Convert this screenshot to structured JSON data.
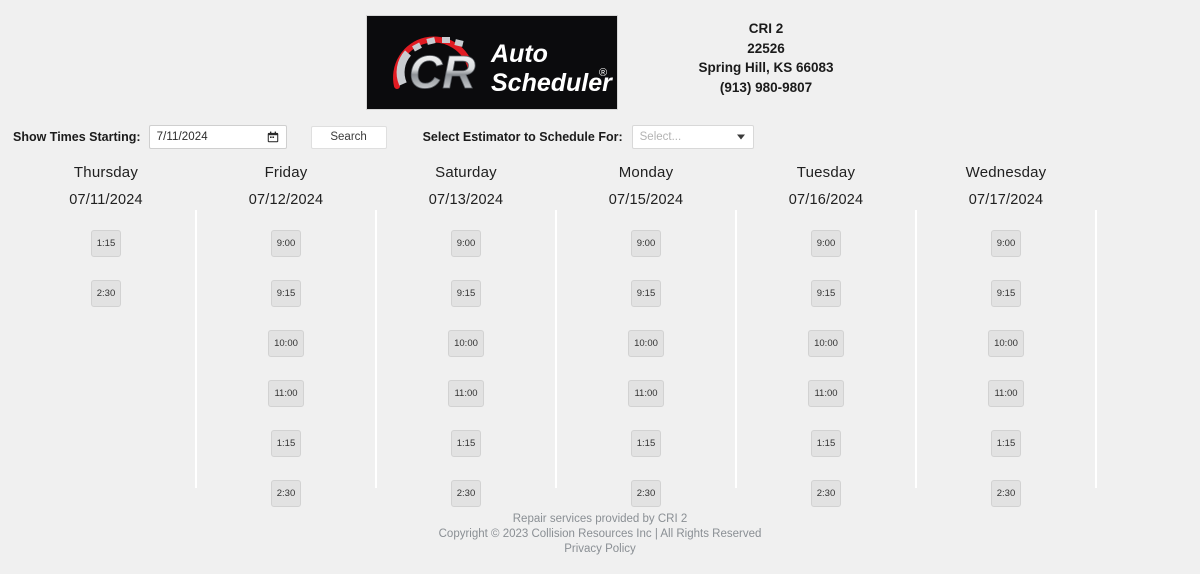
{
  "header": {
    "logo_alt": "CR Auto Scheduler",
    "logo_text_cr": "CR",
    "logo_text_auto": "Auto",
    "logo_text_scheduler": "Scheduler",
    "logo_registered": "®",
    "shop": {
      "name": "CRI 2",
      "number": "22526",
      "city_state_zip": "Spring Hill, KS 66083",
      "phone": "(913) 980-9807"
    }
  },
  "toolbar": {
    "show_times_label": "Show Times Starting:",
    "date_value": "7/11/2024",
    "date_placeholder": "mm/dd/yyyy",
    "calendar_icon": "calendar-icon",
    "search_label": "Search",
    "estimator_label": "Select Estimator to Schedule For:",
    "estimator_selected": "Select...",
    "estimator_caret": "chevron-down-icon"
  },
  "calendar": {
    "days": [
      {
        "name": "Thursday",
        "date": "07/11/2024",
        "slots": [
          "1:15",
          "2:30"
        ]
      },
      {
        "name": "Friday",
        "date": "07/12/2024",
        "slots": [
          "9:00",
          "9:15",
          "10:00",
          "11:00",
          "1:15",
          "2:30"
        ]
      },
      {
        "name": "Saturday",
        "date": "07/13/2024",
        "slots": [
          "9:00",
          "9:15",
          "10:00",
          "11:00",
          "1:15",
          "2:30"
        ]
      },
      {
        "name": "Monday",
        "date": "07/15/2024",
        "slots": [
          "9:00",
          "9:15",
          "10:00",
          "11:00",
          "1:15",
          "2:30"
        ]
      },
      {
        "name": "Tuesday",
        "date": "07/16/2024",
        "slots": [
          "9:00",
          "9:15",
          "10:00",
          "11:00",
          "1:15",
          "2:30"
        ]
      },
      {
        "name": "Wednesday",
        "date": "07/17/2024",
        "slots": [
          "9:00",
          "9:15",
          "10:00",
          "11:00",
          "1:15",
          "2:30"
        ]
      }
    ]
  },
  "footer": {
    "line1": "Repair services provided by CRI 2",
    "line2": "Copyright © 2023 Collision Resources Inc | All Rights Reserved",
    "privacy_label": "Privacy Policy"
  },
  "colors": {
    "page_background": "#f0f0f0",
    "logo_background": "#0b0b0d",
    "logo_accent_red": "#e11b22",
    "slot_background": "#e2e2e2",
    "slot_border": "#d2d2d2",
    "footer_text": "#8a8f94",
    "separator": "#ffffff"
  }
}
